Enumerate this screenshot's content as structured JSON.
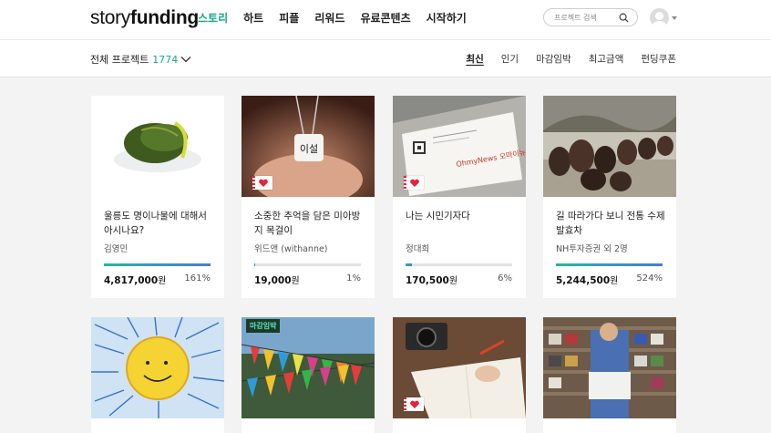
{
  "header": {
    "logo_light": "story",
    "logo_bold": "funding",
    "nav": [
      "스토리",
      "하트",
      "피플",
      "리워드",
      "유료콘텐츠",
      "시작하기"
    ],
    "search_placeholder": "프로젝트 검색"
  },
  "subbar": {
    "filter_label": "전체 프로젝트",
    "filter_count": "1774",
    "sorts": [
      "최신",
      "인기",
      "마감임박",
      "최고금액",
      "펀딩쿠폰"
    ]
  },
  "cards": [
    {
      "title": "울릉도 명이나물에 대해서 아시나요?",
      "author": "김영민",
      "amount": "4,817,000",
      "pct": "161%",
      "progress": 1.0
    },
    {
      "title": "소중한 추억을 담은 미아방지 목걸이",
      "author": "위드앤 (withanne)",
      "amount": "19,000",
      "pct": "1%",
      "progress": 0.01
    },
    {
      "title": "나는 시민기자다",
      "author": "정대희",
      "amount": "170,500",
      "pct": "6%",
      "progress": 0.06
    },
    {
      "title": "길 따라가다 보니 전통 수제 발효차",
      "author": "NH투자증권 외 2명",
      "amount": "5,244,500",
      "pct": "524%",
      "progress": 1.0
    }
  ],
  "card_extras": {
    "currency": "원",
    "deadline_badge": "마감임박"
  },
  "colors": {
    "accent": "#18a58b",
    "progress_start": "#2ab59b",
    "progress_end": "#4a7bd8"
  }
}
